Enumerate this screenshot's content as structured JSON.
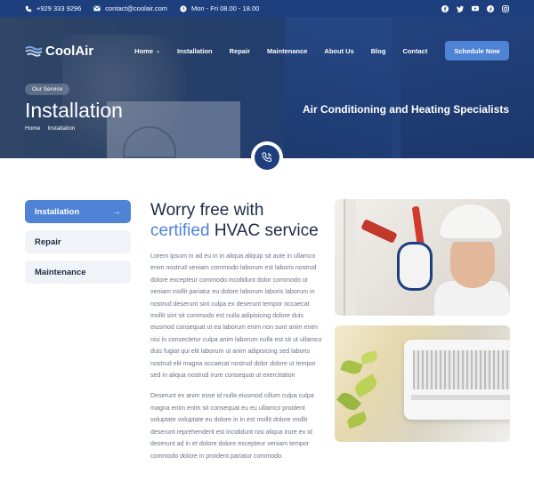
{
  "topbar": {
    "phone": "+929 333 9296",
    "email": "contact@coolair.com",
    "hours": "Mon - Fri 08.00 - 18.00",
    "socials": [
      "facebook-icon",
      "twitter-icon",
      "youtube-icon",
      "pinterest-icon",
      "instagram-icon"
    ]
  },
  "nav": {
    "logo": "CoolAir",
    "items": [
      {
        "label": "Home",
        "has_dropdown": true
      },
      {
        "label": "Installation"
      },
      {
        "label": "Repair"
      },
      {
        "label": "Maintenance"
      },
      {
        "label": "About Us"
      },
      {
        "label": "Blog"
      },
      {
        "label": "Contact"
      }
    ],
    "cta": "Schedule Now"
  },
  "hero": {
    "badge": "Our Service",
    "title": "Installation",
    "breadcrumb": [
      "Home",
      "Installation"
    ],
    "tagline": "Air Conditioning and Heating Specialists"
  },
  "sidebar": {
    "items": [
      {
        "label": "Installation",
        "active": true,
        "arrow": "→"
      },
      {
        "label": "Repair",
        "active": false
      },
      {
        "label": "Maintenance",
        "active": false
      }
    ]
  },
  "content": {
    "heading_line1": "Worry free with",
    "heading_highlight": "certified",
    "heading_rest": "HVAC service",
    "para1": "Lorem ipsum in ad eu in in aliqua aliquip sit aute in ullamco enim nostrud veniam commodo laborum est laboris nostrud dolore excepteur commodo incididunt dolor commodo ut veniam mollit pariatur eu dolore laborum laboris laborum in nostrud deserunt sint culpa ex deserunt tempor occaecat mollit sint sit commodo est nulla adipisicing dolore duis eiusmod consequat ut ea laborum enim non sunt anim enim nisi in consectetur culpa anim laborum nulla est sit ut ullamco duis fugiat qui elit laborum ut anim adipisicing sed laboris nostrud elit magna occaecat nostrud dolor dolore ut tempor sed in aliqua nostrud irure consequat ut exercitation",
    "para2": "Deserunt ex anim esse id nulla eiusmod cillum culpa culpa magna enim enim sit consequat eu eu ullamco proident voluptate voluptate eu dolore in in est mollit dolore mollit deserunt reprehenderit est incididunt nisi aliqua irure ex id deserunt ad in et dolore dolore excepteur veniam tempor commodo dolore in proident pariatur commodo."
  },
  "colors": {
    "primary": "#1e3f7e",
    "accent": "#4f83d6",
    "text": "#1f2a44",
    "muted": "#6b7386",
    "sidebar_bg": "#f0f4f9"
  }
}
